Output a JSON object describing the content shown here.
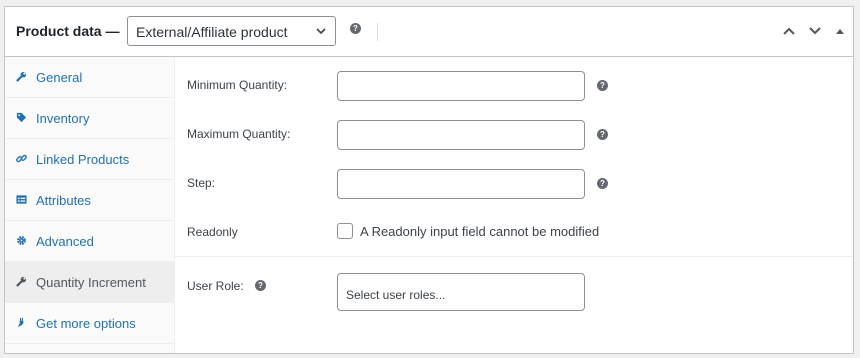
{
  "header": {
    "title": "Product data —",
    "product_type": "External/Affiliate product",
    "help": "?"
  },
  "tabs": [
    {
      "label": "General",
      "icon": "wrench-icon"
    },
    {
      "label": "Inventory",
      "icon": "tag-icon"
    },
    {
      "label": "Linked Products",
      "icon": "link-icon"
    },
    {
      "label": "Attributes",
      "icon": "list-icon"
    },
    {
      "label": "Advanced",
      "icon": "gear-icon"
    },
    {
      "label": "Quantity Increment",
      "icon": "wrench-icon",
      "active": true
    },
    {
      "label": "Get more options",
      "icon": "plugin-icon"
    }
  ],
  "fields": {
    "min_qty_label": "Minimum Quantity:",
    "max_qty_label": "Maximum Quantity:",
    "step_label": "Step:",
    "readonly_label": "Readonly",
    "readonly_checkbox_label": "A Readonly input field cannot be modified",
    "user_role_label": "User Role:",
    "user_role_placeholder": "Select user roles...",
    "help": "?"
  },
  "colors": {
    "link": "#2271b1",
    "border": "#c3c4c7",
    "active_tab_bg": "#eeeeee"
  }
}
